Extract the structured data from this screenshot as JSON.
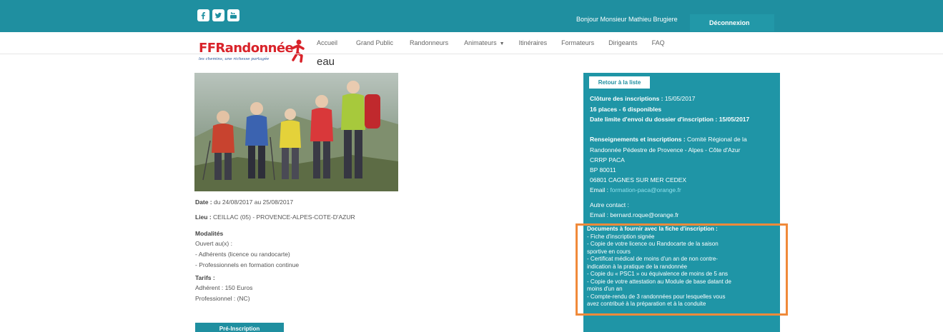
{
  "header": {
    "social": [
      {
        "name": "facebook",
        "icon": "facebook-icon"
      },
      {
        "name": "twitter",
        "icon": "twitter-icon"
      },
      {
        "name": "youtube",
        "icon": "youtube-icon"
      }
    ],
    "greeting": "Bonjour Monsieur Mathieu Brugiere",
    "logout_label": "Déconnexion"
  },
  "brand": {
    "logo_text": "FFRandonnée",
    "tagline": "les chemins, une richesse partagée",
    "title_suffix": "eau"
  },
  "nav": {
    "items": [
      "Accueil",
      "Grand Public",
      "Randonneurs",
      "Animateurs",
      "Itinéraires",
      "Formateurs",
      "Dirigeants",
      "FAQ"
    ],
    "dropdown_caret": "▼"
  },
  "formation": {
    "date_label": "Date :",
    "date_value": "du 24/08/2017 au 25/08/2017",
    "lieu_label": "Lieu :",
    "lieu_value": "CEILLAC (05) - PROVENCE-ALPES-COTE-D'AZUR",
    "modalites_title": "Modalités",
    "modalites_lines": [
      "Ouvert au(x) :",
      "- Adhérents (licence ou randocarte)",
      "- Professionnels en formation continue"
    ],
    "tarifs_title": "Tarifs :",
    "tarifs_lines": [
      "Adhérent : 150 Euros",
      "Professionnel : (NC)"
    ],
    "preinscription_label": "Pré-Inscription"
  },
  "panel": {
    "back_label": "Retour à la liste",
    "cloture_label": "Clôture des inscriptions :",
    "cloture_value": "15/05/2017",
    "places": "16 places - 6 disponibles",
    "date_limite_label": "Date limite d'envoi du dossier d'inscription :",
    "date_limite_value": "15/05/2017",
    "renseignements_label": "Renseignements et inscriptions :",
    "renseignements_first": "Comité Régional de la",
    "address_lines": [
      "Randonnée Pédestre de Provence - Alpes - Côte d'Azur",
      "CRRP PACA",
      "BP 80011",
      "06801 CAGNES SUR MER CEDEX"
    ],
    "email_label": "Email :",
    "email_value": "formation-paca@orange.fr",
    "autre_contact": "Autre contact :",
    "autre_email": "Email : bernard.roque@orange.fr",
    "documents_title": "Documents à fournir avec la fiche d'inscription :",
    "documents_lines": [
      "- Fiche d'inscription signée",
      "- Copie de votre licence ou Randocarte de la saison",
      "sportive en cours",
      "- Certificat médical de moins d'un an de non contre-",
      "indication à la pratique de la randonnée",
      "- Copie du « PSC1 » ou équivalence de moins de 5 ans",
      "- Copie de votre attestation au Module de base datant de",
      "moins d'un an",
      "- Compte-rendu de 3 randonnées pour lesquelles vous",
      "avez contribué à la préparation et à la conduite"
    ]
  },
  "colors": {
    "header_teal": "#1f8fa0",
    "panel_teal": "#1f95a6",
    "highlight_orange": "#f08a3a",
    "brand_red": "#d9232a"
  }
}
